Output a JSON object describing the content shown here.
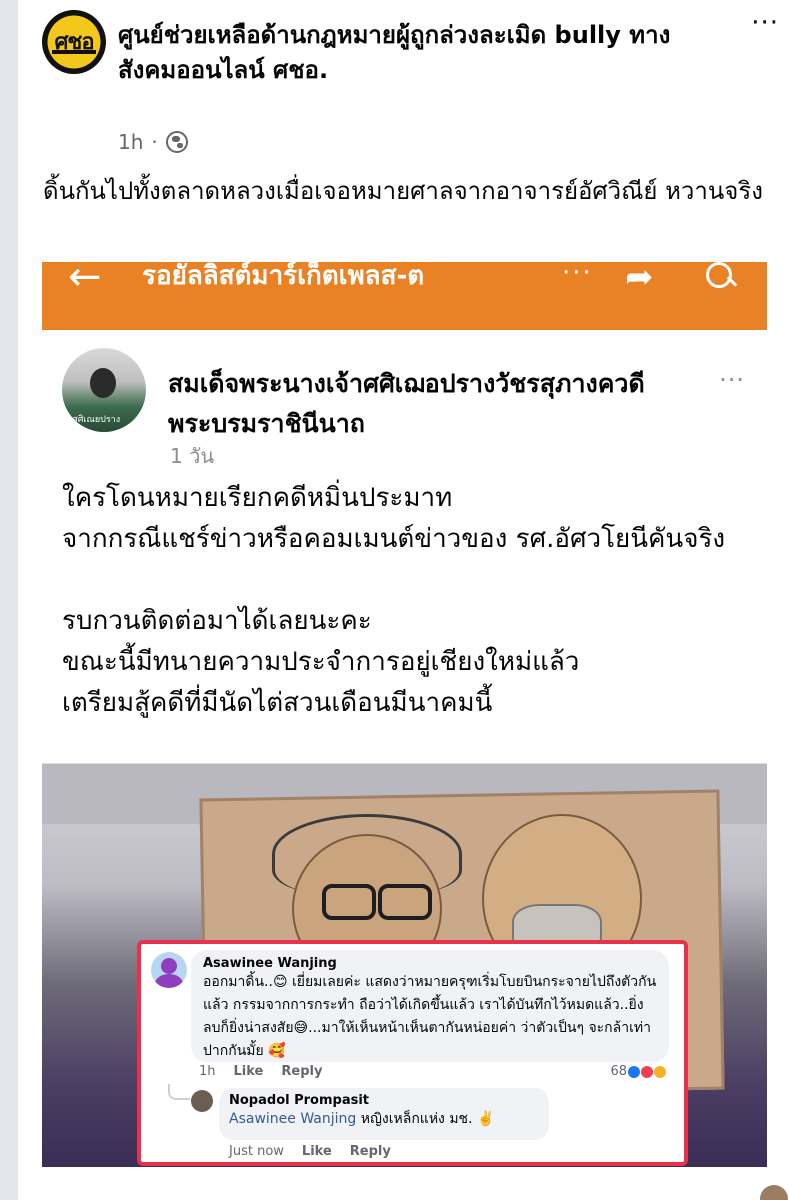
{
  "post": {
    "page_name": "ศูนย์ช่วยเหลือด้านกฎหมายผู้ถูกล่วงละเมิด bully ทางสังคมออนไลน์ ศชอ.",
    "page_logo_text": "ศชอ",
    "more_label": "···",
    "time": "1h",
    "audience_icon": "globe-icon",
    "caption": "ดิ้นกันไปทั้งตลาดหลวงเมื่อเจอหมายศาลจากอาจารย์อัศวิณีย์ หวานจริง"
  },
  "screenshot": {
    "topbar": {
      "back_icon": "←",
      "title": "รอยัลลิสต์มาร์เก็ตเพลส-ต",
      "dots": "···",
      "share_icon": "➦",
      "search_icon": "search-icon"
    },
    "inner_post": {
      "avatar_caption": "ศศิเณยปราง",
      "author": "สมเด็จพระนางเจ้าศศิเฌอปรางวัชรสุภางควดี พระบรมราชินีนาถ",
      "more_label": "···",
      "time": "1 วัน",
      "body_lines": [
        "ใครโดนหมายเรียกคดีหมิ่นประมาท",
        "จากกรณีแชร์ข่าวหรือคอมเมนต์ข่าวของ รศ.อัศวโยนีคันจริง",
        "รบกวนติดต่อมาได้เลยนะคะ",
        "ขณะนี้มีทนายความประจำการอยู่เชียงใหม่แล้ว",
        "เตรียมสู้คดีที่มีนัดไต่สวนเดือนมีนาคมนี้"
      ]
    },
    "comment": {
      "author": "Asawinee Wanjing",
      "text": "ออกมาดิ้น..😊 เยี่ยมเลยค่ะ แสดงว่าหมายครุฑเริ่มโบยบินกระจายไปถึงตัวกันแล้ว กรรมจากการกระทำ ถือว่าได้เกิดขึ้นแล้ว เราได้บันทึกไว้หมดแล้ว..ยิ่งลบก็ยิ่งน่าสงสัย😅...มาให้เห็นหน้าเห็นตากันหน่อยค่า ว่าตัวเป็นๆ จะกล้าเท่าปากกันมั้ย 🥰",
      "time": "1h",
      "like_label": "Like",
      "reply_label": "Reply",
      "reaction_count": "68"
    },
    "reply": {
      "author": "Nopadol Prompasit",
      "mention": "Asawinee Wanjing",
      "text": " หญิงเหล็กแห่ง มช. ✌️",
      "time": "Just now",
      "like_label": "Like",
      "reply_label": "Reply"
    }
  },
  "colors": {
    "topbar": "#e98224",
    "highlight_border": "#e8314a",
    "link": "#385898",
    "meta_text": "#65676b"
  }
}
